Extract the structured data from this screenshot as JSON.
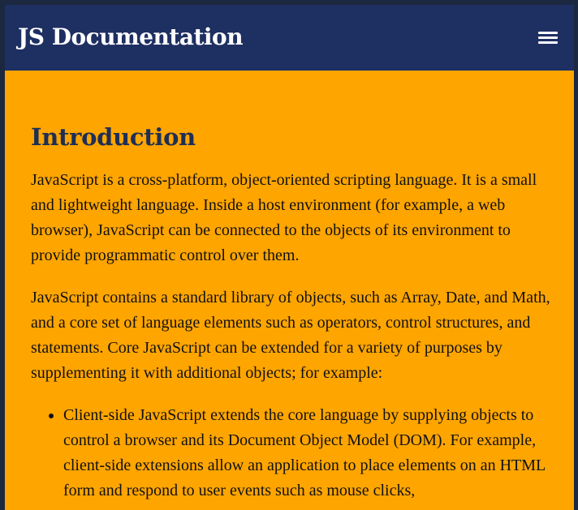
{
  "header": {
    "title": "JS Documentation",
    "menu_icon": "hamburger-menu-icon"
  },
  "main": {
    "heading": "Introduction",
    "paragraphs": [
      "JavaScript is a cross-platform, object-oriented scripting language. It is a small and lightweight language. Inside a host environment (for example, a web browser), JavaScript can be connected to the objects of its environment to provide programmatic control over them.",
      "JavaScript contains a standard library of objects, such as Array, Date, and Math, and a core set of language elements such as operators, control structures, and statements. Core JavaScript can be extended for a variety of purposes by supplementing it with additional objects; for example:"
    ],
    "list_items": [
      "Client-side JavaScript extends the core language by supplying objects to control a browser and its Document Object Model (DOM). For example, client-side extensions allow an application to place elements on an HTML form and respond to user events such as mouse clicks,"
    ]
  },
  "colors": {
    "navbar": "#1e2f62",
    "content_bg": "#ffa500",
    "heading": "#1e2f55",
    "text": "#111111"
  }
}
